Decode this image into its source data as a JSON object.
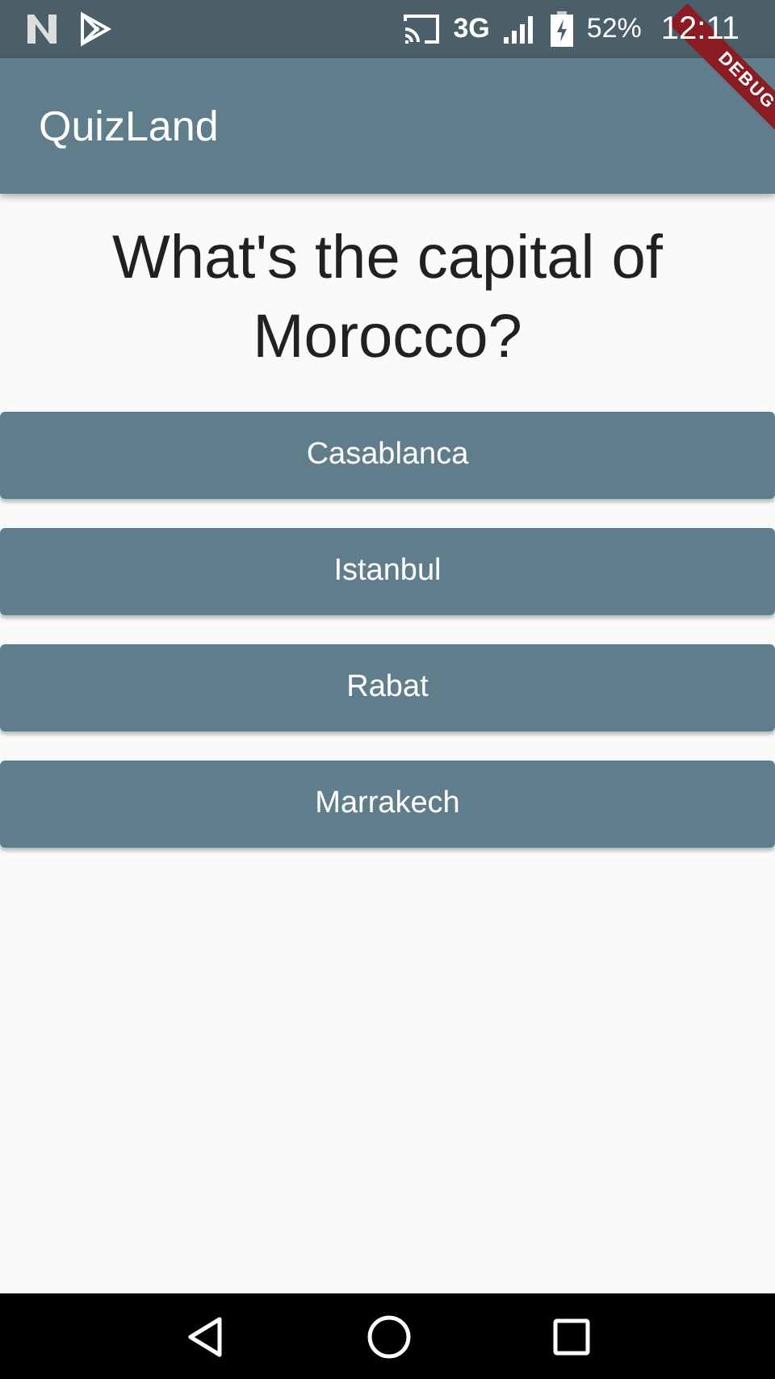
{
  "status_bar": {
    "network": "3G",
    "battery": "52%",
    "time": "12:11"
  },
  "app_bar": {
    "title": "QuizLand"
  },
  "question": "What's the capital of Morocco?",
  "answers": [
    {
      "label": "Casablanca"
    },
    {
      "label": "Istanbul"
    },
    {
      "label": "Rabat"
    },
    {
      "label": "Marrakech"
    }
  ],
  "debug_banner": "DEBUG"
}
